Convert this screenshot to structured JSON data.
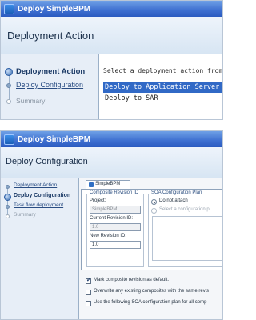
{
  "top": {
    "title": "Deploy SimpleBPM",
    "header": "Deployment Action",
    "steps": [
      {
        "label": "Deployment Action",
        "state": "current"
      },
      {
        "label": "Deploy Configuration",
        "state": "link"
      },
      {
        "label": "Summary",
        "state": "disabled"
      }
    ],
    "instruction": "Select a deployment action from the list be",
    "actions": [
      "Deploy to Application Server",
      "Deploy to SAR"
    ],
    "selected_action": "Deploy to Application Server"
  },
  "bottom": {
    "title": "Deploy SimpleBPM",
    "header": "Deploy Configuration",
    "steps": [
      {
        "label": "Deployment Action",
        "state": "link"
      },
      {
        "label": "Deploy Configuration",
        "state": "current"
      },
      {
        "label": "Task flow deployment",
        "state": "link"
      },
      {
        "label": "Summary",
        "state": "disabled"
      }
    ],
    "tab_label": "SimpleBPM",
    "revision_group": "Composite Revision ID",
    "project_label": "Project:",
    "project_value": "SimpleBPM",
    "current_revision_label": "Current Revision ID:",
    "current_revision_value": "1.0",
    "new_revision_label": "New Revision ID:",
    "new_revision_value": "1.0",
    "soa_group": "SOA Configuration Plan",
    "radio_do_not_attach": "Do not attach",
    "radio_select_plan": "Select a configuration pl",
    "checkbox_mark_default": "Mark composite revision as default.",
    "checkbox_overwrite": "Overwrite any existing composites with the same revis",
    "checkbox_use_soa": "Use the following SOA configuration plan for all comp"
  },
  "colors": {
    "accent": "#3d6fd0",
    "selection": "#3169c6",
    "step_current": "#1b3a66"
  }
}
